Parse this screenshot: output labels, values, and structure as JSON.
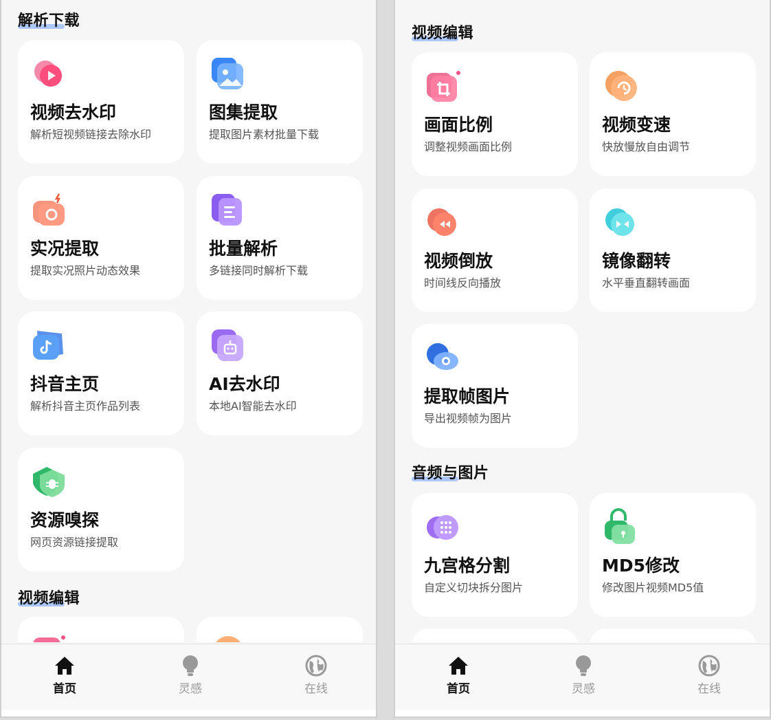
{
  "sections": {
    "download": "解析下载",
    "video_edit": "视频编辑",
    "audio_image": "音频与图片"
  },
  "cards": {
    "watermark": {
      "title": "视频去水印",
      "subtitle": "解析短视频链接去除水印",
      "icon": "play-circle-icon"
    },
    "gallery": {
      "title": "图集提取",
      "subtitle": "提取图片素材批量下载",
      "icon": "image-icon"
    },
    "live": {
      "title": "实况提取",
      "subtitle": "提取实况照片动态效果",
      "icon": "live-camera-icon"
    },
    "batch": {
      "title": "批量解析",
      "subtitle": "多链接同时解析下载",
      "icon": "document-list-icon"
    },
    "douyin": {
      "title": "抖音主页",
      "subtitle": "解析抖音主页作品列表",
      "icon": "tiktok-icon"
    },
    "ai": {
      "title": "AI去水印",
      "subtitle": "本地AI智能去水印",
      "icon": "robot-icon"
    },
    "sniff": {
      "title": "资源嗅探",
      "subtitle": "网页资源链接提取",
      "icon": "bug-shield-icon"
    },
    "ratio": {
      "title": "画面比例",
      "subtitle": "调整视频画面比例",
      "icon": "crop-icon"
    },
    "speed": {
      "title": "视频变速",
      "subtitle": "快放慢放自由调节",
      "icon": "speed-icon"
    },
    "reverse": {
      "title": "视频倒放",
      "subtitle": "时间线反向播放",
      "icon": "rewind-icon"
    },
    "mirror": {
      "title": "镜像翻转",
      "subtitle": "水平垂直翻转画面",
      "icon": "flip-icon"
    },
    "frame": {
      "title": "提取帧图片",
      "subtitle": "导出视频帧为图片",
      "icon": "frame-icon"
    },
    "grid": {
      "title": "九宫格分割",
      "subtitle": "自定义切块拆分图片",
      "icon": "grid-icon"
    },
    "md5": {
      "title": "MD5修改",
      "subtitle": "修改图片视频MD5值",
      "icon": "lock-icon"
    }
  },
  "tabs": {
    "home": "首页",
    "inspire": "灵感",
    "online": "在线"
  },
  "colors": {
    "accent_underline": "#9fc0ff",
    "active_tab": "#111111",
    "inactive_tab": "#999999"
  }
}
